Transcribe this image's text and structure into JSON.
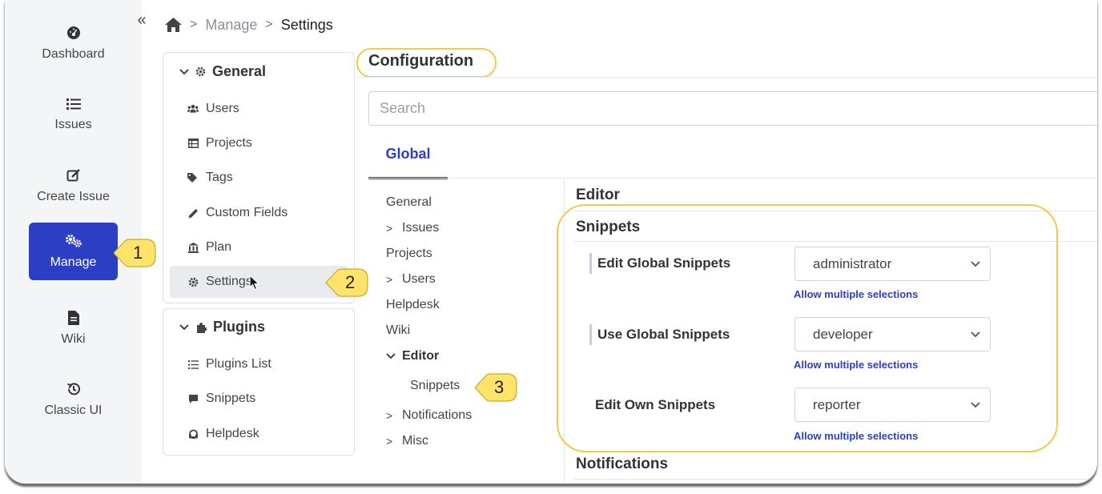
{
  "nav": {
    "items": [
      {
        "label": "Dashboard",
        "icon": "dashboard-icon"
      },
      {
        "label": "Issues",
        "icon": "list-icon"
      },
      {
        "label": "Create Issue",
        "icon": "edit-icon"
      },
      {
        "label": "Manage",
        "icon": "cogs-icon",
        "active": true
      },
      {
        "label": "Wiki",
        "icon": "document-icon"
      },
      {
        "label": "Classic UI",
        "icon": "history-icon"
      }
    ],
    "collapse_glyph": "«"
  },
  "breadcrumb": {
    "manage": "Manage",
    "current": "Settings",
    "separator": ">"
  },
  "general_panel": {
    "title": "General",
    "items": [
      {
        "label": "Users",
        "icon": "users-icon"
      },
      {
        "label": "Projects",
        "icon": "table-icon"
      },
      {
        "label": "Tags",
        "icon": "tags-icon"
      },
      {
        "label": "Custom Fields",
        "icon": "pencil-icon"
      },
      {
        "label": "Plan",
        "icon": "bank-icon"
      },
      {
        "label": "Settings",
        "icon": "gear-icon",
        "selected": true
      }
    ]
  },
  "plugins_panel": {
    "title": "Plugins",
    "items": [
      {
        "label": "Plugins List",
        "icon": "list-icon"
      },
      {
        "label": "Snippets",
        "icon": "comment-icon"
      },
      {
        "label": "Helpdesk",
        "icon": "support-icon"
      }
    ]
  },
  "configuration": {
    "title": "Configuration",
    "search_placeholder": "Search",
    "tab": "Global"
  },
  "tree": [
    {
      "label": "General",
      "chevron": ""
    },
    {
      "label": "Issues",
      "chevron": ">"
    },
    {
      "label": "Projects",
      "chevron": ""
    },
    {
      "label": "Users",
      "chevron": ">"
    },
    {
      "label": "Helpdesk",
      "chevron": ""
    },
    {
      "label": "Wiki",
      "chevron": ""
    },
    {
      "label": "Editor",
      "chevron": "v",
      "expanded": true
    },
    {
      "label": "Snippets",
      "chevron": "",
      "child": true
    },
    {
      "label": "Notifications",
      "chevron": ">"
    },
    {
      "label": "Misc",
      "chevron": ">"
    }
  ],
  "details": {
    "editor_title": "Editor",
    "snippets_title": "Snippets",
    "notifications_title": "Notifications",
    "options": [
      {
        "label": "Edit Global Snippets",
        "value": "administrator",
        "allow": "Allow multiple selections"
      },
      {
        "label": "Use Global Snippets",
        "value": "developer",
        "allow": "Allow multiple selections"
      },
      {
        "label": "Edit Own Snippets",
        "value": "reporter",
        "allow": "Allow multiple selections"
      }
    ]
  },
  "callouts": [
    "1",
    "2",
    "3"
  ],
  "colors": {
    "accent": "#2b3fc4",
    "highlight": "#f2c94c",
    "callout_fill": "#ffe36b",
    "nav_bg": "#f4f5f7"
  }
}
